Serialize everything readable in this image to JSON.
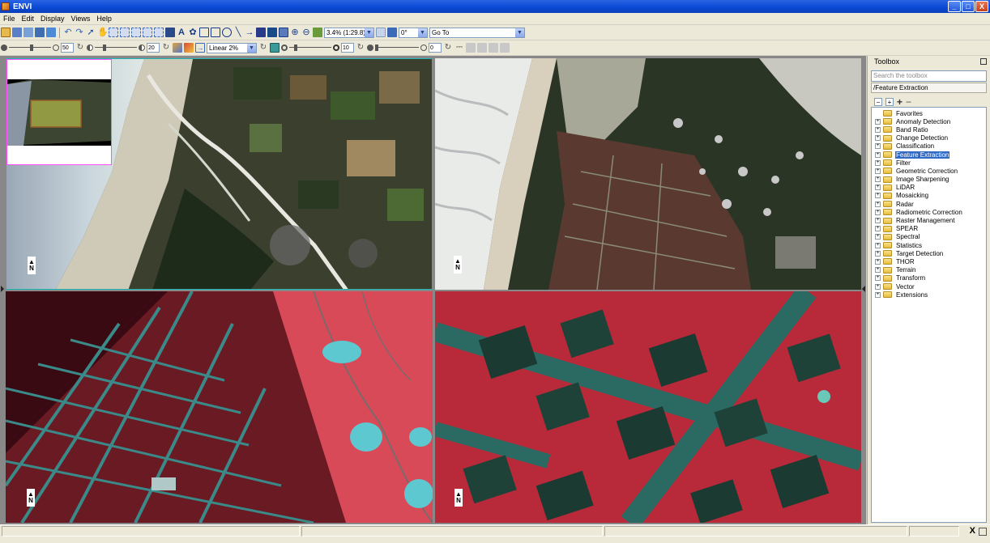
{
  "window": {
    "title": "ENVI",
    "buttons": [
      "_",
      "□",
      "X"
    ]
  },
  "menu": [
    "File",
    "Edit",
    "Display",
    "Views",
    "Help"
  ],
  "toolbar1": {
    "zoom_value": "3.4% (1:29.8)",
    "rotation_value": "0°",
    "goto_value": "Go To"
  },
  "toolbar2": {
    "brightness_value": "50",
    "contrast_value": "20",
    "stretch_value": "Linear 2%",
    "sharpen_value": "10",
    "transparency_value": "0"
  },
  "views": [
    {
      "name": "view-1",
      "north_label": "N",
      "active": true
    },
    {
      "name": "view-2",
      "north_label": "N",
      "active": false
    },
    {
      "name": "view-3",
      "north_label": "N",
      "active": false
    },
    {
      "name": "view-4",
      "north_label": "N",
      "active": false
    }
  ],
  "toolbox": {
    "title": "Toolbox",
    "search_placeholder": "Search the toolbox",
    "path": "/Feature Extraction",
    "items": [
      {
        "label": "Favorites",
        "expandable": false
      },
      {
        "label": "Anomaly Detection",
        "expandable": true
      },
      {
        "label": "Band Ratio",
        "expandable": true
      },
      {
        "label": "Change Detection",
        "expandable": true
      },
      {
        "label": "Classification",
        "expandable": true
      },
      {
        "label": "Feature Extraction",
        "expandable": true,
        "selected": true
      },
      {
        "label": "Filter",
        "expandable": true
      },
      {
        "label": "Geometric Correction",
        "expandable": true
      },
      {
        "label": "Image Sharpening",
        "expandable": true
      },
      {
        "label": "LiDAR",
        "expandable": true
      },
      {
        "label": "Mosaicking",
        "expandable": true
      },
      {
        "label": "Radar",
        "expandable": true
      },
      {
        "label": "Radiometric Correction",
        "expandable": true
      },
      {
        "label": "Raster Management",
        "expandable": true
      },
      {
        "label": "SPEAR",
        "expandable": true
      },
      {
        "label": "Spectral",
        "expandable": true
      },
      {
        "label": "Statistics",
        "expandable": true
      },
      {
        "label": "Target Detection",
        "expandable": true
      },
      {
        "label": "THOR",
        "expandable": true
      },
      {
        "label": "Terrain",
        "expandable": true
      },
      {
        "label": "Transform",
        "expandable": true
      },
      {
        "label": "Vector",
        "expandable": true
      },
      {
        "label": "Extensions",
        "expandable": true
      }
    ]
  },
  "colors": {
    "view_border_active": "#1fb7b5",
    "overview_border": "#ff4fff",
    "selection": "#316ac5"
  },
  "status": {
    "close_glyph": "X"
  }
}
